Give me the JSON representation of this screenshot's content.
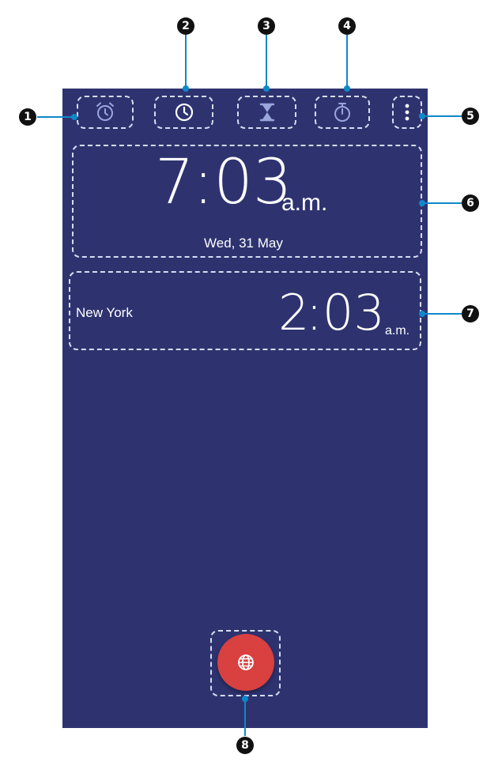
{
  "tabs": [
    {
      "icon": "alarm-icon"
    },
    {
      "icon": "world-clock-icon"
    },
    {
      "icon": "timer-hourglass-icon"
    },
    {
      "icon": "stopwatch-icon"
    },
    {
      "icon": "more-options-icon"
    }
  ],
  "local_clock": {
    "hours": "7",
    "minutes": ":03",
    "period": "a.m.",
    "date": "Wed, 31 May"
  },
  "world_clocks": [
    {
      "city": "New York",
      "hours": "2",
      "minutes": ":03",
      "period": "a.m."
    }
  ],
  "fab": {
    "icon": "globe-icon"
  },
  "callouts": [
    "1",
    "2",
    "3",
    "4",
    "5",
    "6",
    "7",
    "8"
  ],
  "colors": {
    "screen_bg": "#2e3370",
    "fab": "#d94040",
    "leader": "#0f88c9",
    "dashed_outline": "#d7dcf2"
  }
}
